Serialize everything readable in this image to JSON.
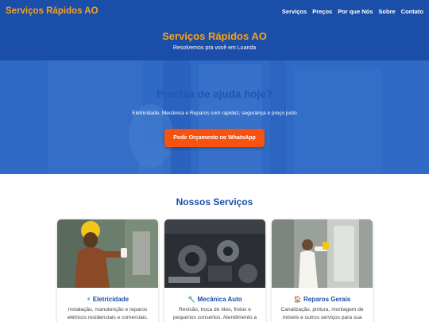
{
  "navbar": {
    "brand": "Serviços Rápidos AO",
    "links": [
      "Serviços",
      "Preços",
      "Por que Nós",
      "Sobre",
      "Contato"
    ]
  },
  "header": {
    "title": "Serviços Rápidos AO",
    "subtitle": "Resolvemos pra você em Luanda"
  },
  "hero": {
    "title": "Precisa de ajuda hoje?",
    "text": "Eletricidade, Mecânica e Reparos com rapidez, segurança e preço justo",
    "cta_label": "Pedir Orçamento no WhatsApp"
  },
  "services": {
    "title": "Nossos Serviços",
    "cards": [
      {
        "icon": "⚡",
        "title": "Eletricidade",
        "text": "Instalação, manutenção e reparos elétricos residenciais e comerciais."
      },
      {
        "icon": "🔧",
        "title": "Mecânica Auto",
        "text": "Revisão, troca de óleo, freios e pequenos consertos. Atendimento a"
      },
      {
        "icon": "🏠",
        "title": "Reparos Gerais",
        "text": "Canalização, pintura, montagem de móveis e outros serviços para sua"
      }
    ]
  },
  "colors": {
    "primary": "#1b4ea8",
    "accent": "#f7a21b",
    "cta": "#f5530f"
  }
}
